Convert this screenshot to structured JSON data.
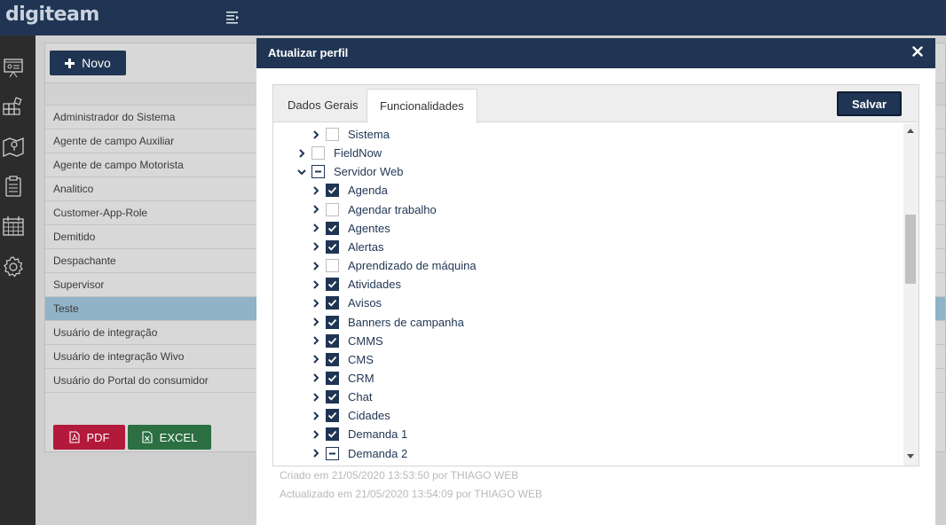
{
  "app": {
    "logo": "digiteam"
  },
  "toolbar": {
    "novo_label": "Novo"
  },
  "profiles": [
    {
      "name": "Administrador do Sistema",
      "selected": false
    },
    {
      "name": "Agente de campo Auxiliar",
      "selected": false
    },
    {
      "name": "Agente de campo Motorista",
      "selected": false
    },
    {
      "name": "Analitico",
      "selected": false
    },
    {
      "name": "Customer-App-Role",
      "selected": false
    },
    {
      "name": "Demitido",
      "selected": false
    },
    {
      "name": "Despachante",
      "selected": false
    },
    {
      "name": "Supervisor",
      "selected": false
    },
    {
      "name": "Teste",
      "selected": true
    },
    {
      "name": "Usuário de integração",
      "selected": false
    },
    {
      "name": "Usuário de integração Wivo",
      "selected": false
    },
    {
      "name": "Usuário do Portal do consumidor",
      "selected": false
    }
  ],
  "export": {
    "pdf_label": "PDF",
    "excel_label": "EXCEL"
  },
  "modal": {
    "title": "Atualizar perfil",
    "tabs": [
      {
        "label": "Dados Gerais",
        "active": false
      },
      {
        "label": "Funcionalidades",
        "active": true
      }
    ],
    "save_label": "Salvar",
    "tree": [
      {
        "label": "Sistema",
        "level": 1,
        "state": "unchecked",
        "expanded": false
      },
      {
        "label": "FieldNow",
        "level": 0,
        "state": "unchecked",
        "expanded": false
      },
      {
        "label": "Servidor Web",
        "level": 0,
        "state": "partial",
        "expanded": true
      },
      {
        "label": "Agenda",
        "level": 1,
        "state": "checked",
        "expanded": false
      },
      {
        "label": "Agendar trabalho",
        "level": 1,
        "state": "unchecked",
        "expanded": false
      },
      {
        "label": "Agentes",
        "level": 1,
        "state": "checked",
        "expanded": false
      },
      {
        "label": "Alertas",
        "level": 1,
        "state": "checked",
        "expanded": false
      },
      {
        "label": "Aprendizado de máquina",
        "level": 1,
        "state": "unchecked",
        "expanded": false
      },
      {
        "label": "Atividades",
        "level": 1,
        "state": "checked",
        "expanded": false
      },
      {
        "label": "Avisos",
        "level": 1,
        "state": "checked",
        "expanded": false
      },
      {
        "label": "Banners de campanha",
        "level": 1,
        "state": "checked",
        "expanded": false
      },
      {
        "label": "CMMS",
        "level": 1,
        "state": "checked",
        "expanded": false
      },
      {
        "label": "CMS",
        "level": 1,
        "state": "checked",
        "expanded": false
      },
      {
        "label": "CRM",
        "level": 1,
        "state": "checked",
        "expanded": false
      },
      {
        "label": "Chat",
        "level": 1,
        "state": "checked",
        "expanded": false
      },
      {
        "label": "Cidades",
        "level": 1,
        "state": "checked",
        "expanded": false
      },
      {
        "label": "Demanda 1",
        "level": 1,
        "state": "checked",
        "expanded": false
      },
      {
        "label": "Demanda 2",
        "level": 1,
        "state": "partial",
        "expanded": false
      }
    ],
    "created_text": "Criado em 21/05/2020 13:53:50 por THIAGO WEB",
    "updated_text": "Actualizado em 21/05/2020 13:54:09 por THIAGO WEB"
  },
  "colors": {
    "primary": "#1f3553",
    "selected_row": "#90b3c7",
    "pdf": "#b2193b",
    "excel": "#2b6f42"
  }
}
